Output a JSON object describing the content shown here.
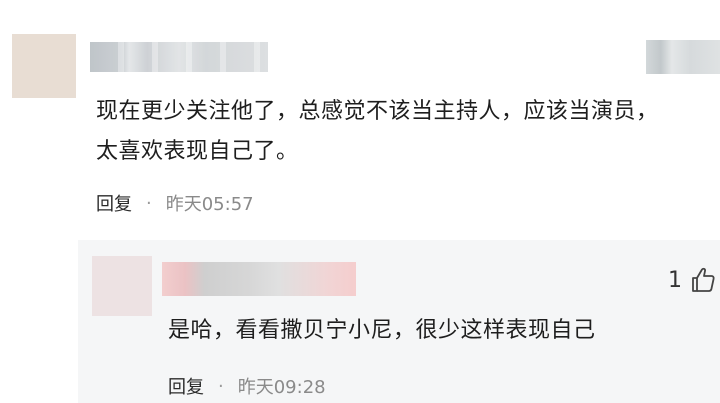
{
  "comment": {
    "text": "现在更少关注他了，总感觉不该当主持人，应该当演员，\n太喜欢表现自己了。",
    "reply_label": "回复",
    "separator": "·",
    "time": "昨天05:57"
  },
  "reply": {
    "text": "是哈，看看撒贝宁小尼，很少这样表现自己",
    "reply_label": "回复",
    "separator": "·",
    "time": "昨天09:28",
    "like_count": "1",
    "like_icon": "thumbs-up-icon"
  }
}
